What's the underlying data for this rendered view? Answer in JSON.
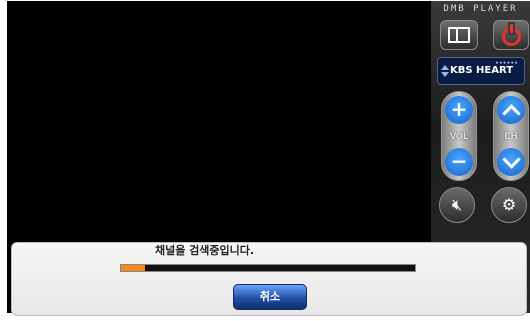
{
  "app": {
    "brand": "DMB PLAYER",
    "channel_name": "KBS HEART",
    "vol_label": "VOL",
    "ch_label": "CH"
  },
  "dialog": {
    "message": "채널을 검색중입니다.",
    "cancel_label": "취소",
    "progress_percent": 8
  },
  "icons": {
    "screen_mode": "screen-mode-icon",
    "power": "power-icon",
    "volume_up": "plus-icon",
    "volume_down": "minus-icon",
    "channel_up": "chevron-up-icon",
    "channel_down": "chevron-down-icon",
    "mute": "speaker-mute-icon",
    "settings": "gear-icon"
  },
  "colors": {
    "accent_blue": "#1462c9",
    "power_red": "#e8322a",
    "progress_orange": "#f08a1f"
  }
}
